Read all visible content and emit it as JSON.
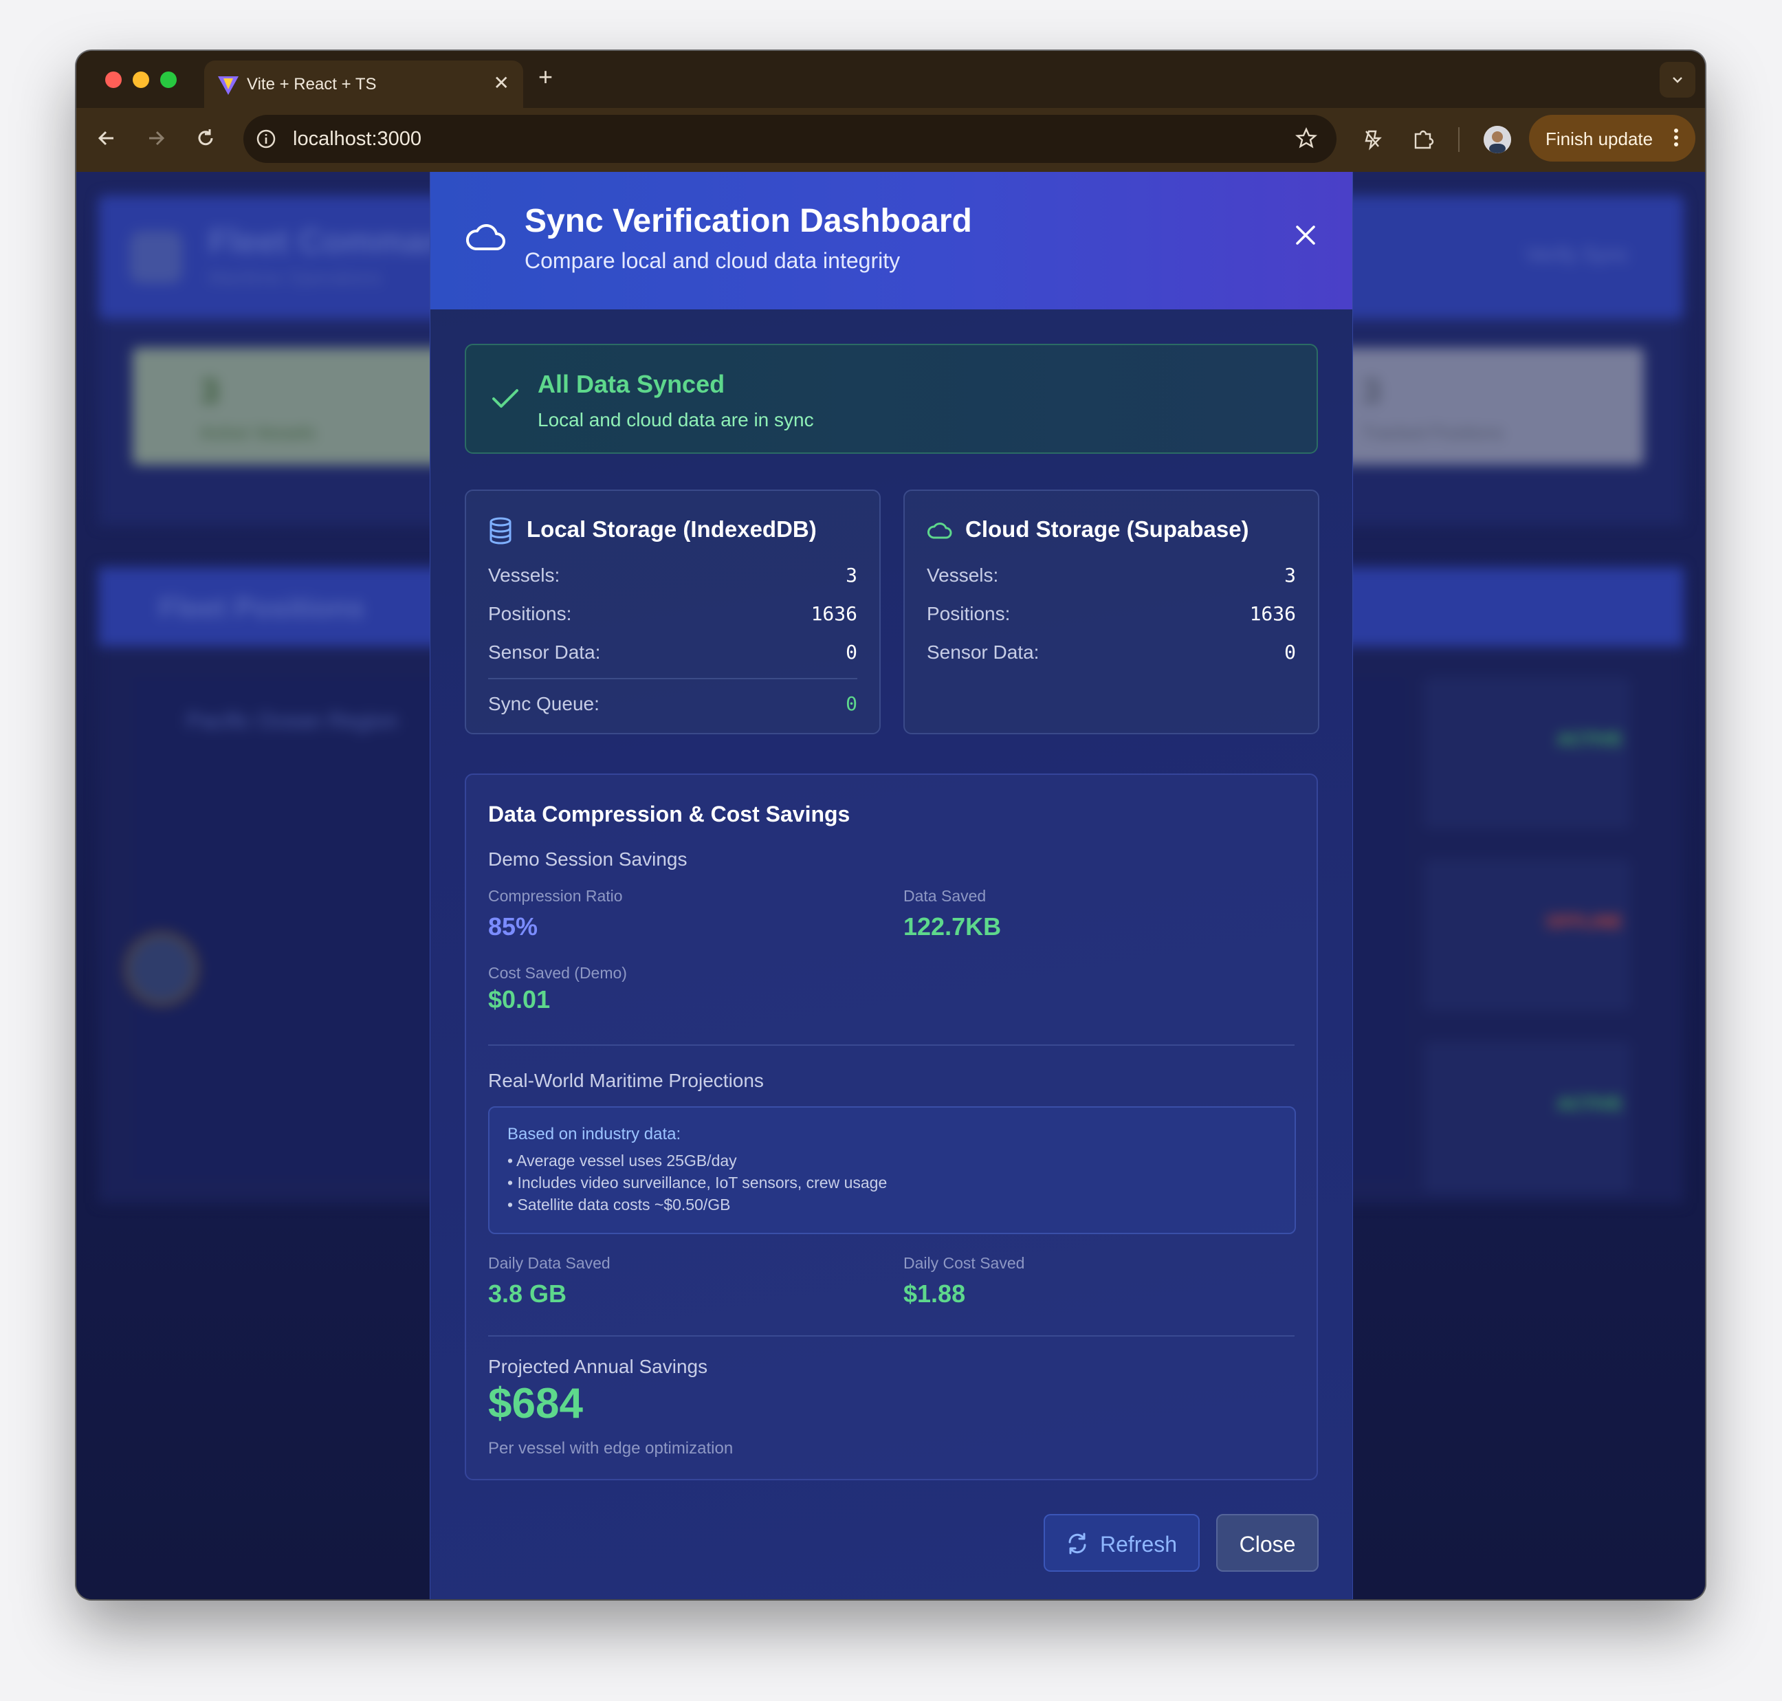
{
  "browser": {
    "tab_title": "Vite + React + TS",
    "url": "localhost:3000",
    "finish_update_label": "Finish update",
    "icons": [
      "back-arrow-icon",
      "forward-arrow-icon",
      "reload-icon",
      "info-icon",
      "star-icon",
      "extensions-icon",
      "puzzle-icon",
      "more-vert-icon"
    ]
  },
  "background": {
    "header_title": "Fleet Command",
    "header_subtitle": "Maritime Operations",
    "header_right": "Verify Sync",
    "stat_left_value": "3",
    "stat_left_label": "Active Vessels",
    "stat_right_value": "3",
    "stat_right_label": "Tracked Positions",
    "fleet_title": "Fleet Positions",
    "region": "Pacific Ocean Region",
    "status_1": "ACTIVE",
    "status_2": "OFFLINE",
    "status_3": "ACTIVE"
  },
  "modal": {
    "title": "Sync Verification Dashboard",
    "subtitle": "Compare local and cloud data integrity",
    "status": {
      "title": "All Data Synced",
      "subtitle": "Local and cloud data are in sync"
    },
    "local": {
      "title": "Local Storage (IndexedDB)",
      "rows": [
        {
          "label": "Vessels:",
          "value": "3"
        },
        {
          "label": "Positions:",
          "value": "1636"
        },
        {
          "label": "Sensor Data:",
          "value": "0"
        }
      ],
      "queue_label": "Sync Queue:",
      "queue_value": "0"
    },
    "cloud": {
      "title": "Cloud Storage (Supabase)",
      "rows": [
        {
          "label": "Vessels:",
          "value": "3"
        },
        {
          "label": "Positions:",
          "value": "1636"
        },
        {
          "label": "Sensor Data:",
          "value": "0"
        }
      ]
    },
    "savings": {
      "title": "Data Compression & Cost Savings",
      "demo_heading": "Demo Session Savings",
      "compression_label": "Compression Ratio",
      "compression_value": "85%",
      "data_saved_label": "Data Saved",
      "data_saved_value": "122.7KB",
      "cost_saved_label": "Cost Saved (Demo)",
      "cost_saved_value": "$0.01",
      "projections_heading": "Real-World Maritime Projections",
      "industry_title": "Based on industry data:",
      "industry_items": [
        "• Average vessel uses 25GB/day",
        "• Includes video surveillance, IoT sensors, crew usage",
        "• Satellite data costs ~$0.50/GB"
      ],
      "daily_data_label": "Daily Data Saved",
      "daily_data_value": "3.8 GB",
      "daily_cost_label": "Daily Cost Saved",
      "daily_cost_value": "$1.88",
      "annual_label": "Projected Annual Savings",
      "annual_value": "$684",
      "annual_note": "Per vessel with edge optimization"
    },
    "buttons": {
      "refresh": "Refresh",
      "close": "Close"
    },
    "colors": {
      "accent_green": "#5ed88c",
      "accent_purple": "#7b8cff",
      "header_start": "#2e4fc4",
      "header_end": "#4a40c8"
    }
  }
}
